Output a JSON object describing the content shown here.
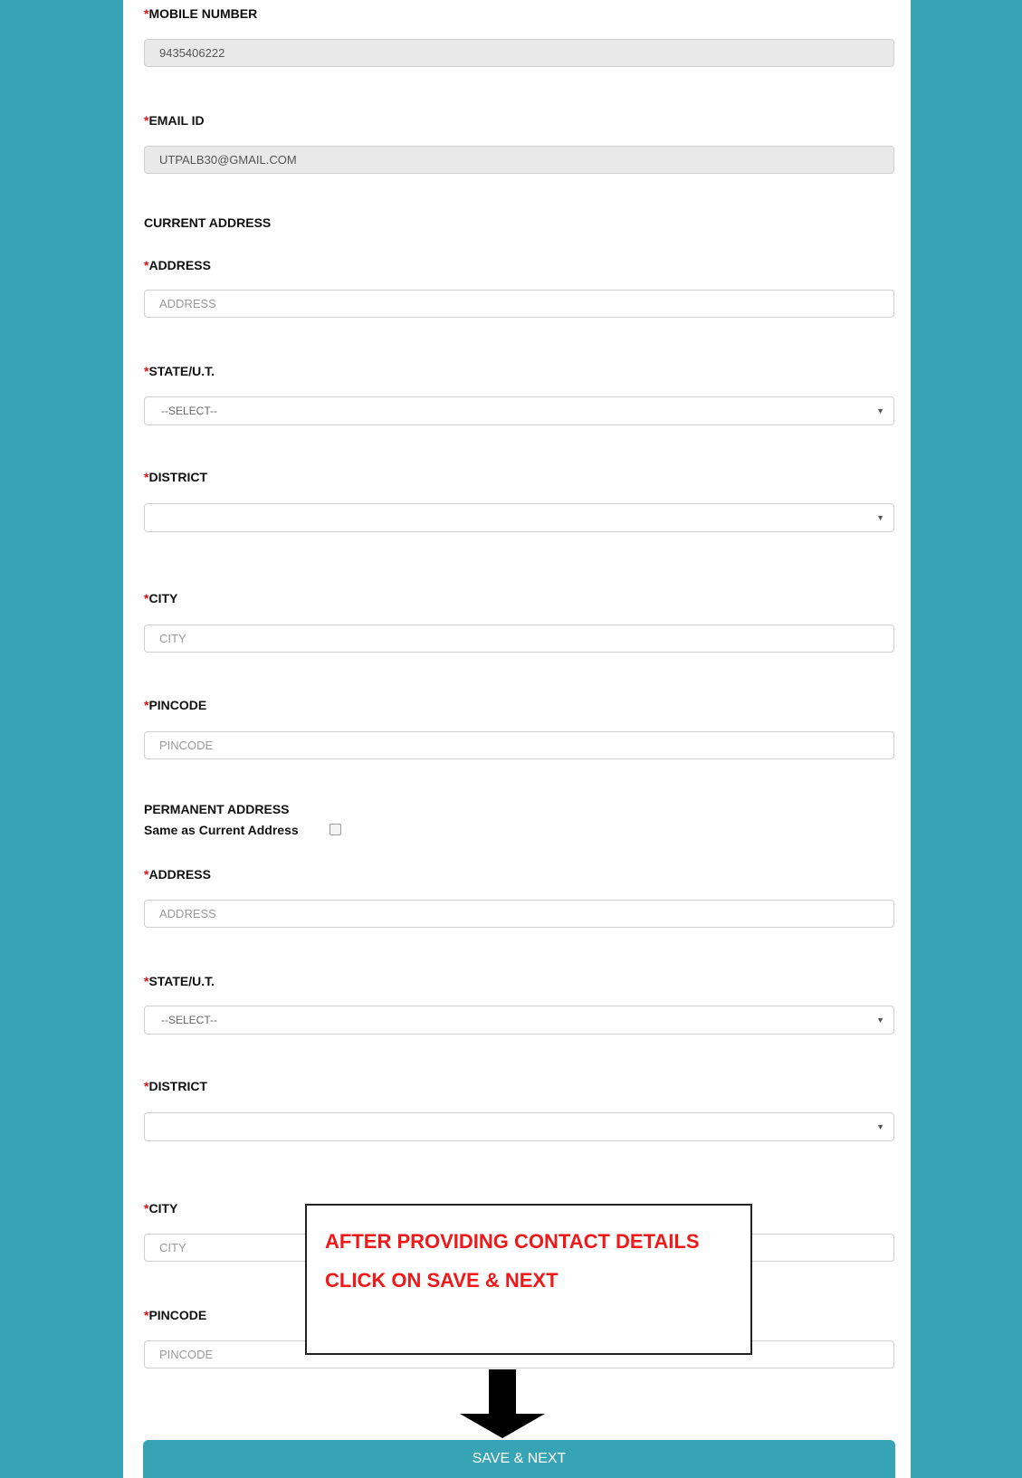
{
  "required_mark": "*",
  "contact": {
    "mobile": {
      "label": "MOBILE NUMBER",
      "value": "9435406222"
    },
    "email": {
      "label": "EMAIL ID",
      "value": "UTPALB30@GMAIL.COM"
    }
  },
  "current_address": {
    "heading": "CURRENT ADDRESS",
    "address": {
      "label": "ADDRESS",
      "placeholder": "ADDRESS"
    },
    "state": {
      "label": "STATE/U.T.",
      "selected": "--SELECT--"
    },
    "district": {
      "label": "DISTRICT",
      "selected": ""
    },
    "city": {
      "label": "CITY",
      "placeholder": "CITY"
    },
    "pincode": {
      "label": "PINCODE",
      "placeholder": "PINCODE"
    }
  },
  "permanent_address": {
    "heading": "PERMANENT ADDRESS",
    "same_as_label": "Same as Current Address",
    "same_as_checked": false,
    "address": {
      "label": "ADDRESS",
      "placeholder": "ADDRESS"
    },
    "state": {
      "label": "STATE/U.T.",
      "selected": "--SELECT--"
    },
    "district": {
      "label": "DISTRICT",
      "selected": ""
    },
    "city": {
      "label": "CITY",
      "placeholder": "CITY"
    },
    "pincode": {
      "label": "PINCODE",
      "placeholder": "PINCODE"
    }
  },
  "callout": {
    "line1": "AFTER PROVIDING CONTACT DETAILS",
    "line2": "CLICK ON SAVE & NEXT"
  },
  "save_button": {
    "label": "SAVE & NEXT"
  },
  "colors": {
    "background": "#37a4b6",
    "button": "#37a4b6",
    "required_star": "#e01010",
    "callout_text": "#f01818"
  },
  "icons": {
    "select_caret": "▼",
    "arrow": "down-arrow-icon"
  }
}
